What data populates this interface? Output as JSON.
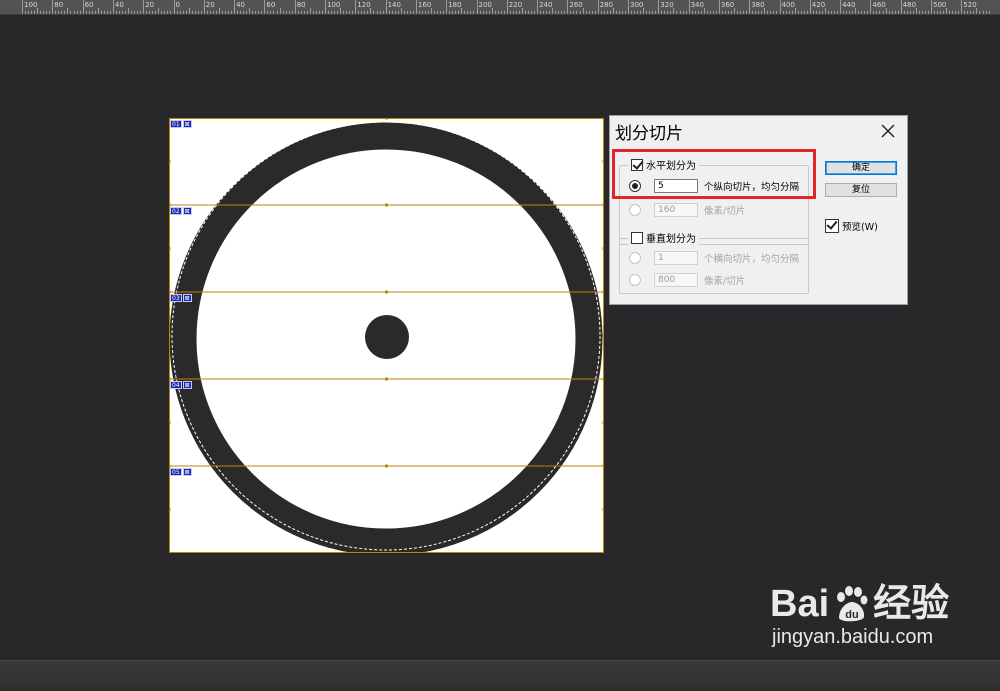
{
  "ruler": {
    "labels": [
      "100",
      "80",
      "60",
      "40",
      "20",
      "0",
      "20",
      "40",
      "60",
      "80",
      "100",
      "120",
      "140",
      "160",
      "180",
      "200",
      "220",
      "240",
      "260",
      "280",
      "300",
      "320",
      "340",
      "360",
      "380",
      "400",
      "420",
      "440",
      "460",
      "480",
      "500",
      "520"
    ]
  },
  "slices": {
    "tags": [
      {
        "num": "01",
        "badge": "⊠"
      },
      {
        "num": "02",
        "badge": "⊠"
      },
      {
        "num": "03",
        "badge": "⊠"
      },
      {
        "num": "04",
        "badge": "⊠"
      },
      {
        "num": "05",
        "badge": "⊠"
      }
    ],
    "line_color": "#b8860b"
  },
  "dialog": {
    "title": "划分切片",
    "horizontal": {
      "label": "水平划分为",
      "checked": true,
      "count_value": "5",
      "count_label": "个纵向切片，均匀分隔",
      "pixels_value": "160",
      "pixels_label": "像素/切片"
    },
    "vertical": {
      "label": "垂直划分为",
      "checked": false,
      "count_value": "1",
      "count_label": "个横向切片，均匀分隔",
      "pixels_value": "800",
      "pixels_label": "像素/切片"
    },
    "ok_label": "确定",
    "reset_label": "复位",
    "preview_label": "预览(W)",
    "preview_checked": true
  },
  "watermark": {
    "brand_left": "Bai",
    "brand_right": "经验",
    "url": "jingyan.baidu.com"
  },
  "colors": {
    "workspace": "#282729",
    "ring": "#2b2929",
    "highlight": "#e0262c"
  }
}
